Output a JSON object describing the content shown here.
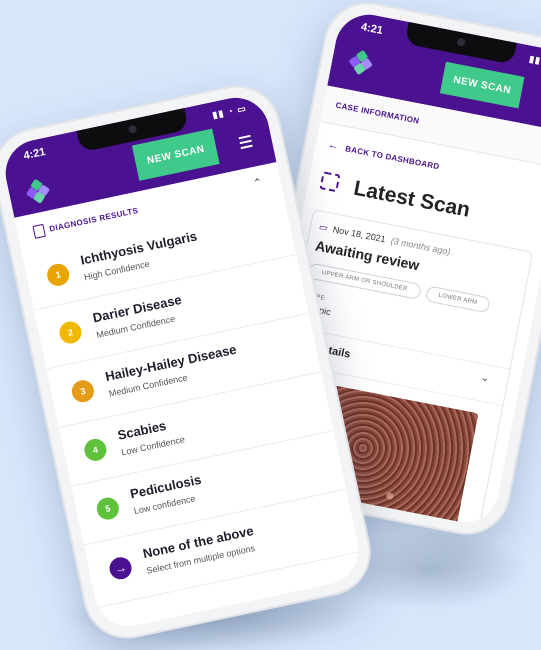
{
  "colors": {
    "brand_purple": "#4a1190",
    "accent_green": "#3fc98b",
    "high_confidence": "#e8a400",
    "medium_confidence": "#f0b900",
    "medium_confidence_orange": "#e69a1a",
    "low_confidence": "#5fc23a",
    "none_option": "#4a1190"
  },
  "back_phone": {
    "status_time": "4:21",
    "new_scan_label": "NEW SCAN",
    "case_information_label": "CASE INFORMATION",
    "back_to_dashboard_label": "BACK TO DASHBOARD",
    "page_title": "Latest Scan",
    "scan": {
      "date": "Nov 18, 2021",
      "relative": "(3 months ago)",
      "status": "Awaiting review",
      "locations": [
        "UPPER ARM OR SHOULDER",
        "LOWER ARM"
      ],
      "type_label": "TYPE",
      "type_value": "scopic",
      "details_label": "details"
    }
  },
  "front_phone": {
    "status_time": "4:21",
    "new_scan_label": "NEW SCAN",
    "diagnosis_results_label": "DIAGNOSIS RESULTS",
    "results": [
      {
        "rank": "1",
        "name": "Ichthyosis Vulgaris",
        "confidence": "High Confidence"
      },
      {
        "rank": "2",
        "name": "Darier Disease",
        "confidence": "Medium Confidence"
      },
      {
        "rank": "3",
        "name": "Hailey-Hailey Disease",
        "confidence": "Medium Confidence"
      },
      {
        "rank": "4",
        "name": "Scabies",
        "confidence": "Low Confidence"
      },
      {
        "rank": "5",
        "name": "Pediculosis",
        "confidence": "Low confidence"
      }
    ],
    "none_option": {
      "title": "None of the above",
      "subtitle": "Select from multiple options"
    }
  }
}
